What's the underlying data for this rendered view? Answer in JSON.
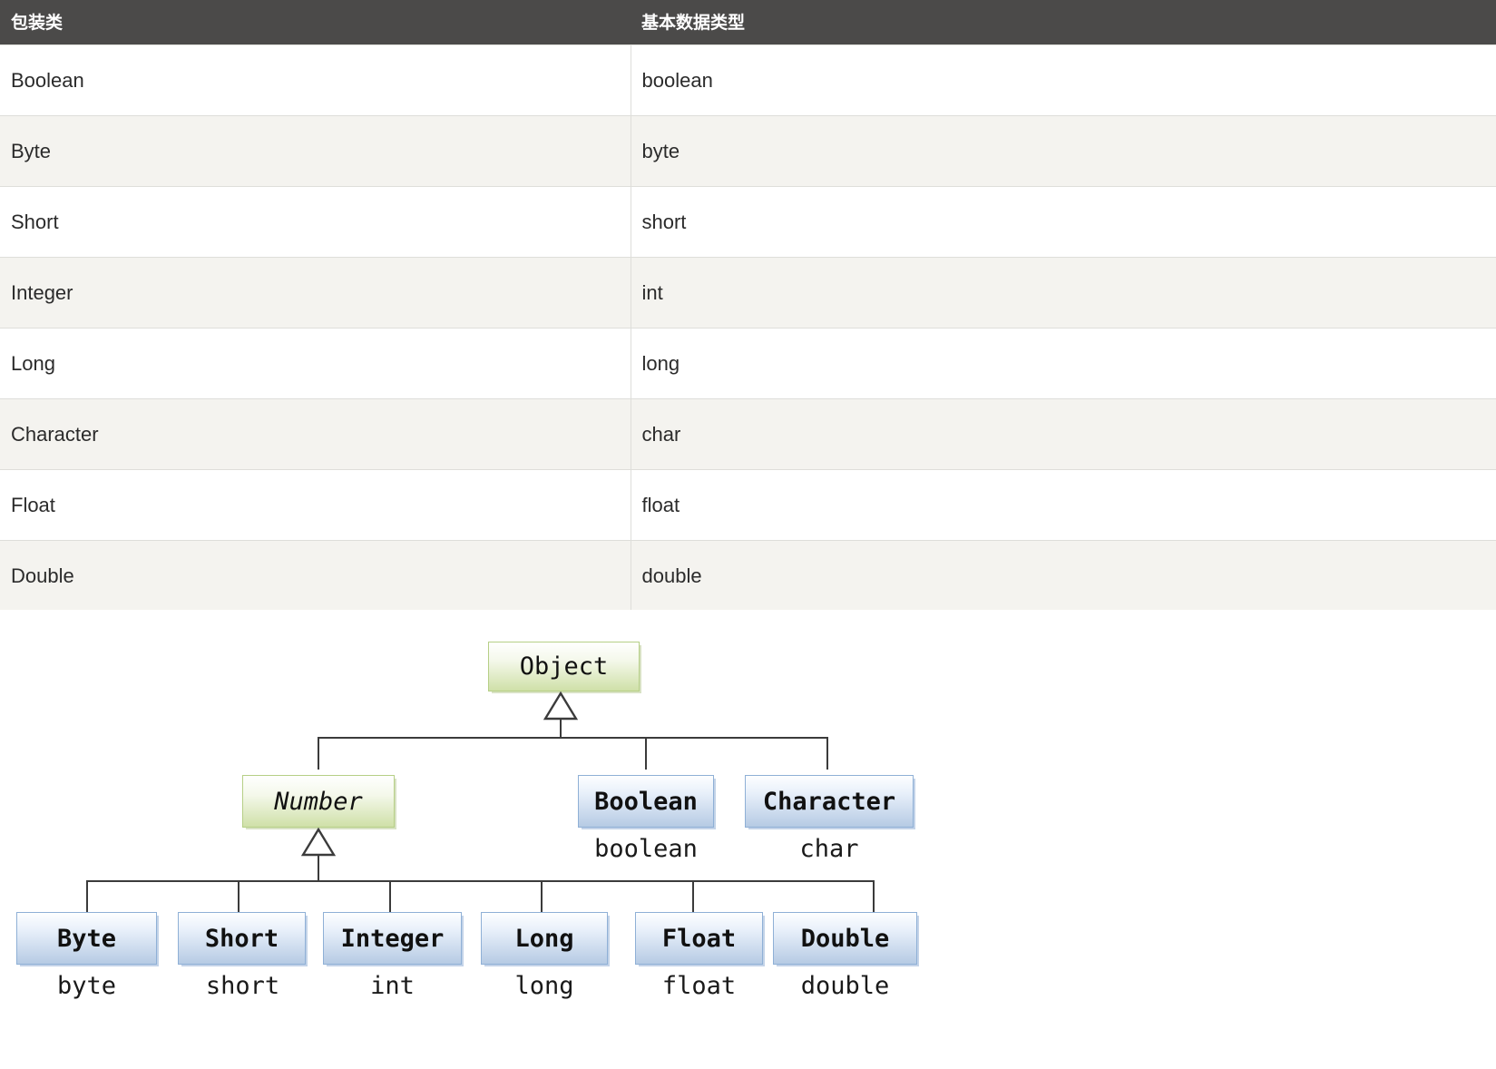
{
  "table": {
    "headers": [
      "包装类",
      "基本数据类型"
    ],
    "rows": [
      {
        "wrapper": "Boolean",
        "primitive": "boolean"
      },
      {
        "wrapper": "Byte",
        "primitive": "byte"
      },
      {
        "wrapper": "Short",
        "primitive": "short"
      },
      {
        "wrapper": "Integer",
        "primitive": "int"
      },
      {
        "wrapper": "Long",
        "primitive": "long"
      },
      {
        "wrapper": "Character",
        "primitive": "char"
      },
      {
        "wrapper": "Float",
        "primitive": "float"
      },
      {
        "wrapper": "Double",
        "primitive": "double"
      }
    ],
    "header_bg": "#4b4a49",
    "header_text_color": "#ffffff",
    "row_bg_odd": "#ffffff",
    "row_bg_even": "#f4f3ef",
    "border_color": "#dededa"
  },
  "diagram": {
    "root": {
      "label": "Object",
      "style": "green"
    },
    "level2": [
      {
        "label": "Number",
        "style": "green",
        "italic": true,
        "primitive": ""
      },
      {
        "label": "Boolean",
        "style": "blue",
        "italic": false,
        "primitive": "boolean"
      },
      {
        "label": "Character",
        "style": "blue",
        "italic": false,
        "primitive": "char"
      }
    ],
    "level3": [
      {
        "label": "Byte",
        "style": "blue",
        "primitive": "byte"
      },
      {
        "label": "Short",
        "style": "blue",
        "primitive": "short"
      },
      {
        "label": "Integer",
        "style": "blue",
        "primitive": "int"
      },
      {
        "label": "Long",
        "style": "blue",
        "primitive": "long"
      },
      {
        "label": "Float",
        "style": "blue",
        "primitive": "float"
      },
      {
        "label": "Double",
        "style": "blue",
        "primitive": "double"
      }
    ],
    "colors": {
      "green_fill": "#cfe0a8",
      "green_border": "#b6cf86",
      "blue_fill": "#b6cbe4",
      "blue_border": "#8fb0d6",
      "connector": "#3b3b3b",
      "arrow_fill": "#ffffff"
    }
  }
}
